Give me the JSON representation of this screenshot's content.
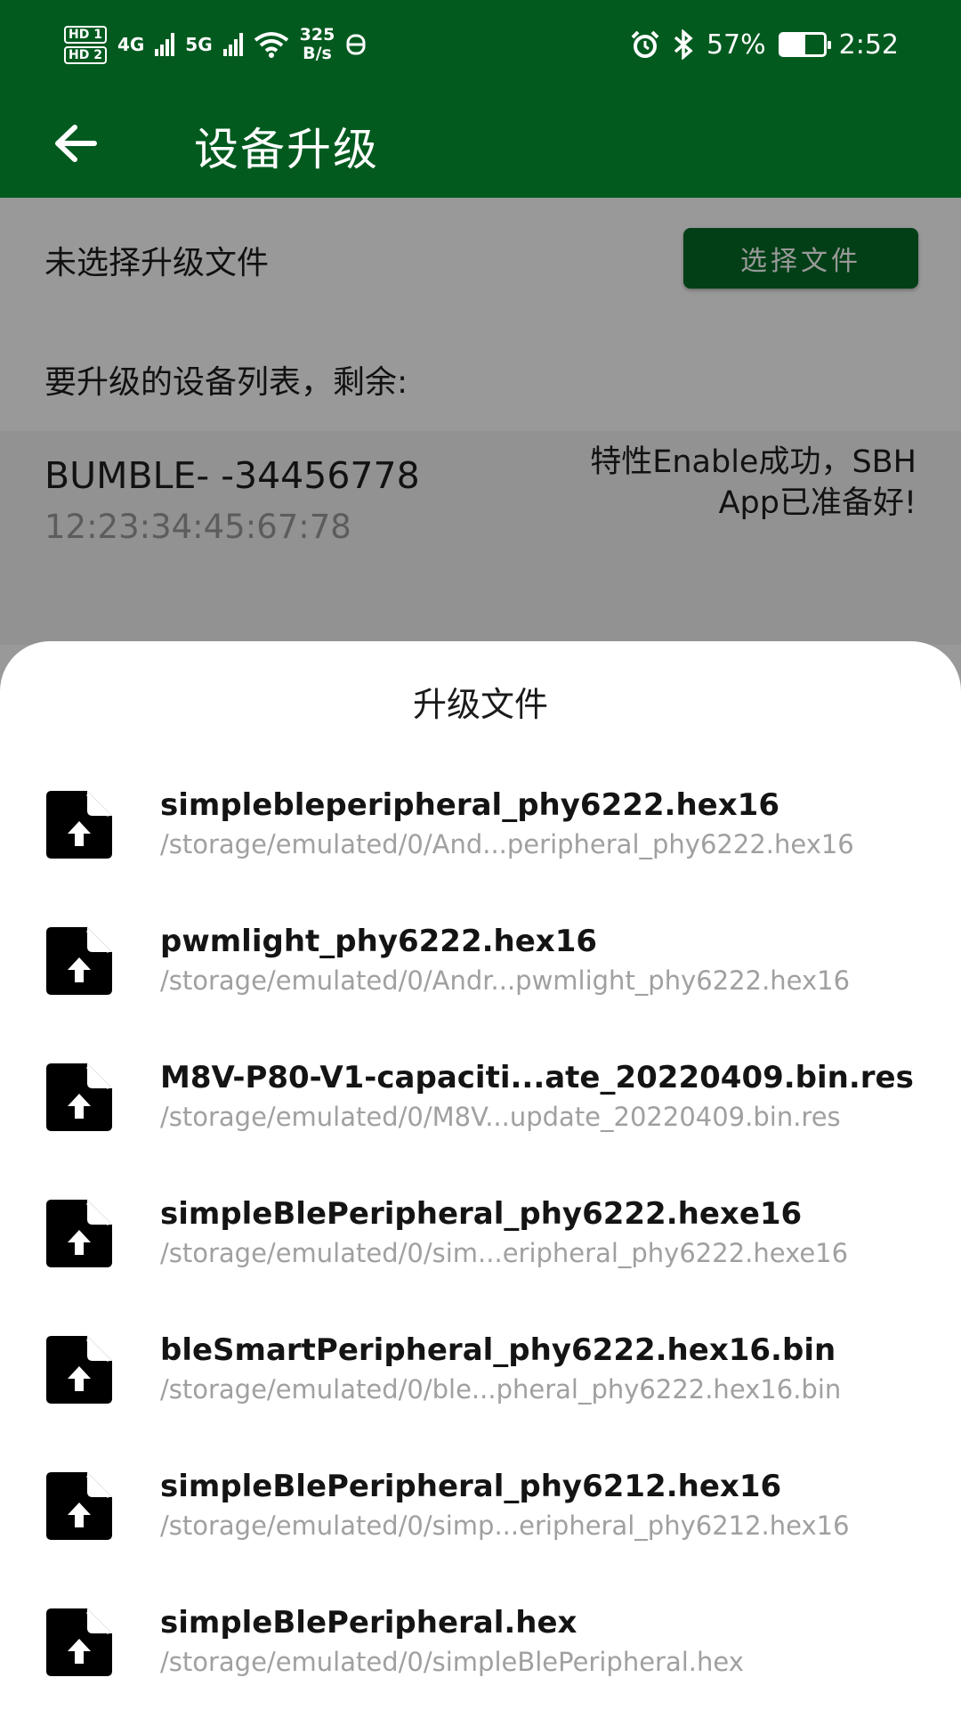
{
  "status_bar": {
    "hd1": "HD 1",
    "hd2": "HD 2",
    "net1": "4G",
    "net2": "5G",
    "speed_value": "325",
    "speed_unit": "B/s",
    "battery": "57%",
    "time": "2:52"
  },
  "app_bar": {
    "title": "设备升级"
  },
  "file_select": {
    "no_file_text": "未选择升级文件",
    "choose_button": "选择文件"
  },
  "device_list": {
    "label": "要升级的设备列表，剩余:",
    "devices": [
      {
        "name": "BUMBLE- -34456778",
        "mac": "12:23:34:45:67:78",
        "status": "特性Enable成功，SBH App已准备好!"
      }
    ]
  },
  "sheet": {
    "title": "升级文件",
    "files": [
      {
        "name": "simplebleperipheral_phy6222.hex16",
        "path": "/storage/emulated/0/And...peripheral_phy6222.hex16"
      },
      {
        "name": "pwmlight_phy6222.hex16",
        "path": "/storage/emulated/0/Andr...pwmlight_phy6222.hex16"
      },
      {
        "name": "M8V-P80-V1-capaciti...ate_20220409.bin.res",
        "path": "/storage/emulated/0/M8V...update_20220409.bin.res"
      },
      {
        "name": "simpleBlePeripheral_phy6222.hexe16",
        "path": "/storage/emulated/0/sim...eripheral_phy6222.hexe16"
      },
      {
        "name": "bleSmartPeripheral_phy6222.hex16.bin",
        "path": "/storage/emulated/0/ble...pheral_phy6222.hex16.bin"
      },
      {
        "name": "simpleBlePeripheral_phy6212.hex16",
        "path": "/storage/emulated/0/simp...eripheral_phy6212.hex16"
      },
      {
        "name": "simpleBlePeripheral.hex",
        "path": "/storage/emulated/0/simpleBlePeripheral.hex"
      }
    ]
  },
  "colors": {
    "primary": "#025a1f",
    "button": "#046a26",
    "icon": "#000000"
  },
  "icons": {
    "back": "arrow-left-icon",
    "file": "file-upload-icon",
    "alarm": "alarm-icon",
    "bluetooth": "bluetooth-icon",
    "wifi": "wifi-icon",
    "battery": "battery-charging-icon"
  }
}
